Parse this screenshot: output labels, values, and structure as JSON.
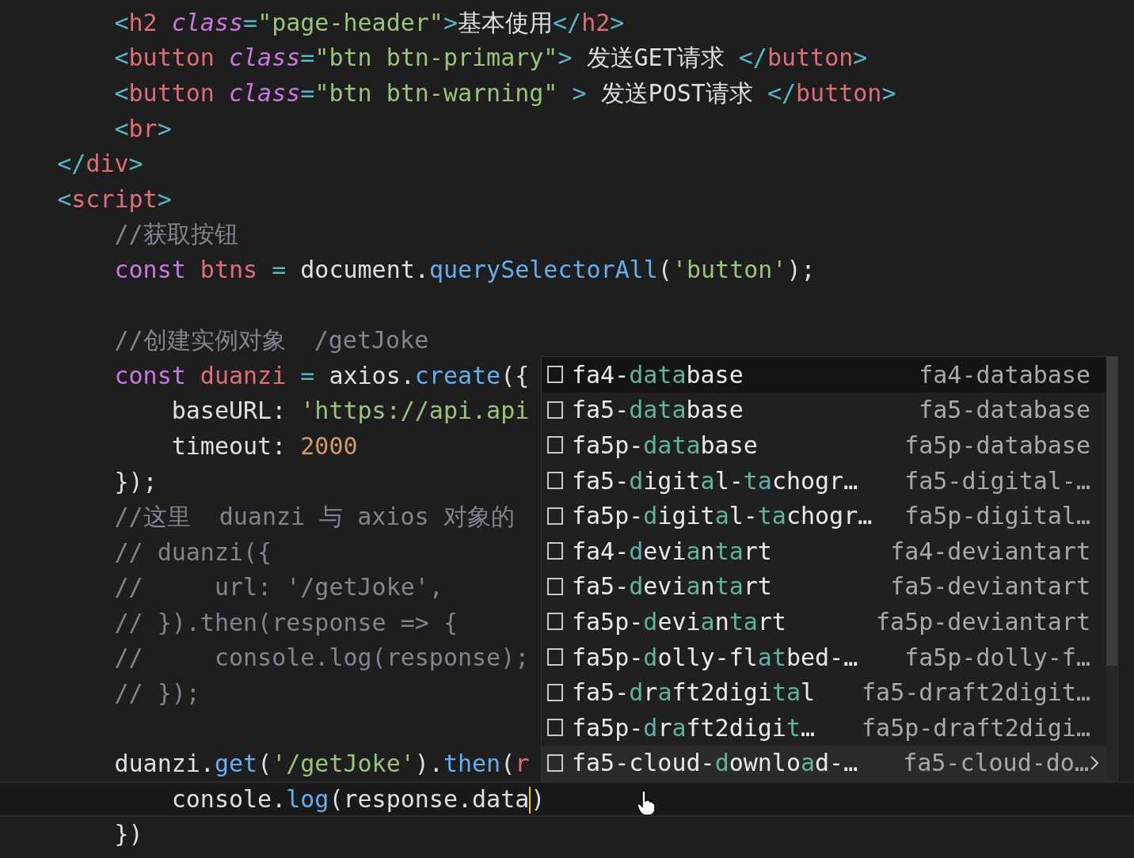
{
  "editor": {
    "lines": [
      {
        "current": false,
        "tokens": [
          {
            "kind": "p",
            "text": "        <"
          },
          {
            "kind": "tag",
            "text": "h2"
          },
          {
            "kind": "attr",
            "text": " class"
          },
          {
            "kind": "p",
            "text": "="
          },
          {
            "kind": "str",
            "text": "\"page-header\""
          },
          {
            "kind": "p",
            "text": ">"
          },
          {
            "kind": "txt",
            "text": "基本使用"
          },
          {
            "kind": "p",
            "text": "</"
          },
          {
            "kind": "tag",
            "text": "h2"
          },
          {
            "kind": "p",
            "text": ">"
          }
        ]
      },
      {
        "current": false,
        "tokens": [
          {
            "kind": "p",
            "text": "        <"
          },
          {
            "kind": "tag",
            "text": "button"
          },
          {
            "kind": "attr",
            "text": " class"
          },
          {
            "kind": "p",
            "text": "="
          },
          {
            "kind": "str",
            "text": "\"btn btn-primary\""
          },
          {
            "kind": "p",
            "text": ">"
          },
          {
            "kind": "txt",
            "text": " 发送GET请求 "
          },
          {
            "kind": "p",
            "text": "</"
          },
          {
            "kind": "tag",
            "text": "button"
          },
          {
            "kind": "p",
            "text": ">"
          }
        ]
      },
      {
        "current": false,
        "tokens": [
          {
            "kind": "p",
            "text": "        <"
          },
          {
            "kind": "tag",
            "text": "button"
          },
          {
            "kind": "attr",
            "text": " class"
          },
          {
            "kind": "p",
            "text": "="
          },
          {
            "kind": "str",
            "text": "\"btn btn-warning\""
          },
          {
            "kind": "p",
            "text": " >"
          },
          {
            "kind": "txt",
            "text": " 发送POST请求 "
          },
          {
            "kind": "p",
            "text": "</"
          },
          {
            "kind": "tag",
            "text": "button"
          },
          {
            "kind": "p",
            "text": ">"
          }
        ]
      },
      {
        "current": false,
        "tokens": [
          {
            "kind": "p",
            "text": "        <"
          },
          {
            "kind": "tag",
            "text": "br"
          },
          {
            "kind": "p",
            "text": ">"
          }
        ]
      },
      {
        "current": false,
        "tokens": [
          {
            "kind": "p",
            "text": "    </"
          },
          {
            "kind": "tag",
            "text": "div"
          },
          {
            "kind": "p",
            "text": ">"
          }
        ]
      },
      {
        "current": false,
        "tokens": [
          {
            "kind": "p",
            "text": "    <"
          },
          {
            "kind": "tag",
            "text": "script"
          },
          {
            "kind": "p",
            "text": ">"
          }
        ]
      },
      {
        "current": false,
        "tokens": [
          {
            "kind": "cmt",
            "text": "        //获取按钮"
          }
        ]
      },
      {
        "current": false,
        "tokens": [
          {
            "kind": "kw",
            "text": "        const"
          },
          {
            "kind": "var",
            "text": " btns"
          },
          {
            "kind": "p",
            "text": " ="
          },
          {
            "kind": "txt",
            "text": " document."
          },
          {
            "kind": "fn",
            "text": "querySelectorAll"
          },
          {
            "kind": "txt",
            "text": "("
          },
          {
            "kind": "str",
            "text": "'button'"
          },
          {
            "kind": "txt",
            "text": ");"
          }
        ]
      },
      {
        "current": false
      },
      {
        "current": false,
        "tokens": [
          {
            "kind": "cmt",
            "text": "        //创建实例对象  /getJoke"
          }
        ]
      },
      {
        "current": false,
        "tokens": [
          {
            "kind": "kw",
            "text": "        const"
          },
          {
            "kind": "var",
            "text": " duanzi"
          },
          {
            "kind": "p",
            "text": " ="
          },
          {
            "kind": "txt",
            "text": " axios."
          },
          {
            "kind": "fn",
            "text": "create"
          },
          {
            "kind": "txt",
            "text": "({"
          }
        ]
      },
      {
        "current": false,
        "tokens": [
          {
            "kind": "txt",
            "text": "            baseURL: "
          },
          {
            "kind": "str",
            "text": "'https://api.api"
          }
        ]
      },
      {
        "current": false,
        "tokens": [
          {
            "kind": "txt",
            "text": "            timeout: "
          },
          {
            "kind": "num",
            "text": "2000"
          }
        ]
      },
      {
        "current": false,
        "tokens": [
          {
            "kind": "txt",
            "text": "        });"
          }
        ]
      },
      {
        "current": false,
        "tokens": [
          {
            "kind": "cmt",
            "text": "        //这里  duanzi 与 axios 对象的"
          }
        ]
      },
      {
        "current": false,
        "tokens": [
          {
            "kind": "cmt",
            "text": "        // duanzi({"
          }
        ]
      },
      {
        "current": false,
        "tokens": [
          {
            "kind": "cmt",
            "text": "        //     url: '/getJoke',"
          }
        ]
      },
      {
        "current": false,
        "tokens": [
          {
            "kind": "cmt",
            "text": "        // }).then(response => {"
          }
        ]
      },
      {
        "current": false,
        "tokens": [
          {
            "kind": "cmt",
            "text": "        //     console.log(response);"
          }
        ]
      },
      {
        "current": false,
        "tokens": [
          {
            "kind": "cmt",
            "text": "        // });"
          }
        ]
      },
      {
        "current": false
      },
      {
        "current": false,
        "tokens": [
          {
            "kind": "txt",
            "text": "        duanzi."
          },
          {
            "kind": "fn",
            "text": "get"
          },
          {
            "kind": "txt",
            "text": "("
          },
          {
            "kind": "str",
            "text": "'/getJoke'"
          },
          {
            "kind": "txt",
            "text": ")."
          },
          {
            "kind": "fn",
            "text": "then"
          },
          {
            "kind": "txt",
            "text": "("
          },
          {
            "kind": "var",
            "text": "r"
          }
        ]
      },
      {
        "current": true,
        "tokens": [
          {
            "kind": "txt",
            "text": "            console."
          },
          {
            "kind": "fn",
            "text": "log"
          },
          {
            "kind": "txt",
            "text": "(response.data"
          },
          {
            "kind": "cursor"
          },
          {
            "kind": "txt",
            "text": ")"
          }
        ]
      },
      {
        "current": false,
        "tokens": [
          {
            "kind": "txt",
            "text": "        })"
          }
        ]
      }
    ]
  },
  "suggestions": {
    "items": [
      {
        "selected": true,
        "hovered": false,
        "detail": "fa4-database",
        "parts": [
          {
            "text": "fa4-",
            "match": false
          },
          {
            "text": "data",
            "match": true
          },
          {
            "text": "base",
            "match": false
          }
        ]
      },
      {
        "selected": false,
        "hovered": false,
        "detail": "fa5-database",
        "parts": [
          {
            "text": "fa5-",
            "match": false
          },
          {
            "text": "data",
            "match": true
          },
          {
            "text": "base",
            "match": false
          }
        ]
      },
      {
        "selected": false,
        "hovered": false,
        "detail": "fa5p-database",
        "parts": [
          {
            "text": "fa5p-",
            "match": false
          },
          {
            "text": "data",
            "match": true
          },
          {
            "text": "base",
            "match": false
          }
        ]
      },
      {
        "selected": false,
        "hovered": false,
        "detail": "fa5-digital-…",
        "parts": [
          {
            "text": "fa5-",
            "match": false
          },
          {
            "text": "d",
            "match": true
          },
          {
            "text": "igit",
            "match": false
          },
          {
            "text": "a",
            "match": true
          },
          {
            "text": "l-",
            "match": false
          },
          {
            "text": "ta",
            "match": true
          },
          {
            "text": "chogr…",
            "match": false
          }
        ]
      },
      {
        "selected": false,
        "hovered": false,
        "detail": "fa5p-digital…",
        "parts": [
          {
            "text": "fa5p-",
            "match": false
          },
          {
            "text": "d",
            "match": true
          },
          {
            "text": "igit",
            "match": false
          },
          {
            "text": "a",
            "match": true
          },
          {
            "text": "l-",
            "match": false
          },
          {
            "text": "ta",
            "match": true
          },
          {
            "text": "chogr…",
            "match": false
          }
        ]
      },
      {
        "selected": false,
        "hovered": false,
        "detail": "fa4-deviantart",
        "parts": [
          {
            "text": "fa4-",
            "match": false
          },
          {
            "text": "d",
            "match": true
          },
          {
            "text": "evi",
            "match": false
          },
          {
            "text": "a",
            "match": true
          },
          {
            "text": "n",
            "match": false
          },
          {
            "text": "ta",
            "match": true
          },
          {
            "text": "rt",
            "match": false
          }
        ]
      },
      {
        "selected": false,
        "hovered": false,
        "detail": "fa5-deviantart",
        "parts": [
          {
            "text": "fa5-",
            "match": false
          },
          {
            "text": "d",
            "match": true
          },
          {
            "text": "evi",
            "match": false
          },
          {
            "text": "a",
            "match": true
          },
          {
            "text": "n",
            "match": false
          },
          {
            "text": "ta",
            "match": true
          },
          {
            "text": "rt",
            "match": false
          }
        ]
      },
      {
        "selected": false,
        "hovered": false,
        "detail": "fa5p-deviantart",
        "parts": [
          {
            "text": "fa5p-",
            "match": false
          },
          {
            "text": "d",
            "match": true
          },
          {
            "text": "evi",
            "match": false
          },
          {
            "text": "a",
            "match": true
          },
          {
            "text": "n",
            "match": false
          },
          {
            "text": "ta",
            "match": true
          },
          {
            "text": "rt",
            "match": false
          }
        ]
      },
      {
        "selected": false,
        "hovered": false,
        "detail": "fa5p-dolly-f…",
        "parts": [
          {
            "text": "fa5p-",
            "match": false
          },
          {
            "text": "d",
            "match": true
          },
          {
            "text": "olly-fl",
            "match": false
          },
          {
            "text": "at",
            "match": true
          },
          {
            "text": "bed-…",
            "match": false
          }
        ]
      },
      {
        "selected": false,
        "hovered": false,
        "detail": "fa5-draft2digit…",
        "parts": [
          {
            "text": "fa5-",
            "match": false
          },
          {
            "text": "d",
            "match": true
          },
          {
            "text": "r",
            "match": false
          },
          {
            "text": "a",
            "match": true
          },
          {
            "text": "ft2digi",
            "match": false
          },
          {
            "text": "ta",
            "match": true
          },
          {
            "text": "l",
            "match": false
          }
        ]
      },
      {
        "selected": false,
        "hovered": false,
        "detail": "fa5p-draft2digi…",
        "parts": [
          {
            "text": "fa5p-",
            "match": false
          },
          {
            "text": "d",
            "match": true
          },
          {
            "text": "r",
            "match": false
          },
          {
            "text": "a",
            "match": true
          },
          {
            "text": "ft2digi",
            "match": false
          },
          {
            "text": "t",
            "match": true
          },
          {
            "text": "…",
            "match": false
          }
        ]
      },
      {
        "selected": false,
        "hovered": true,
        "detail": "fa5-cloud-do…",
        "parts": [
          {
            "text": "fa5-cloud-",
            "match": false
          },
          {
            "text": "d",
            "match": true
          },
          {
            "text": "ownlo",
            "match": false
          },
          {
            "text": "a",
            "match": true
          },
          {
            "text": "d-…",
            "match": false
          }
        ]
      }
    ]
  }
}
